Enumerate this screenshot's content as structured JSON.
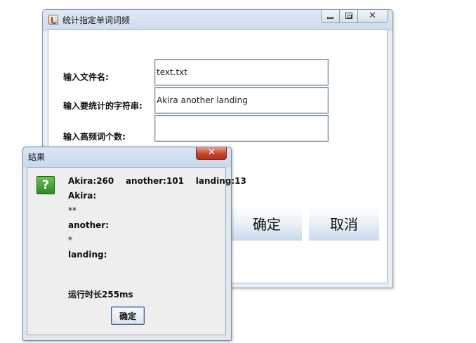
{
  "main_window": {
    "title": "统计指定单词词频",
    "form": {
      "filename_label": "输入文件名:",
      "filename_value": "text.txt",
      "words_label": "输入要统计的字符串:",
      "words_value": "Akira another landing",
      "topn_label": "输入高频词个数:",
      "topn_value": ""
    },
    "buttons": {
      "confirm_label": "确定",
      "cancel_label": "取消"
    }
  },
  "dialog": {
    "title": "结果",
    "icon": "question-icon",
    "icon_glyph": "?",
    "lines": [
      "Akira:260    another:101    landing:13",
      "Akira:",
      "**",
      "another:",
      "*",
      "landing:"
    ],
    "runtime": "运行时长255ms",
    "ok_label": "确定"
  }
}
